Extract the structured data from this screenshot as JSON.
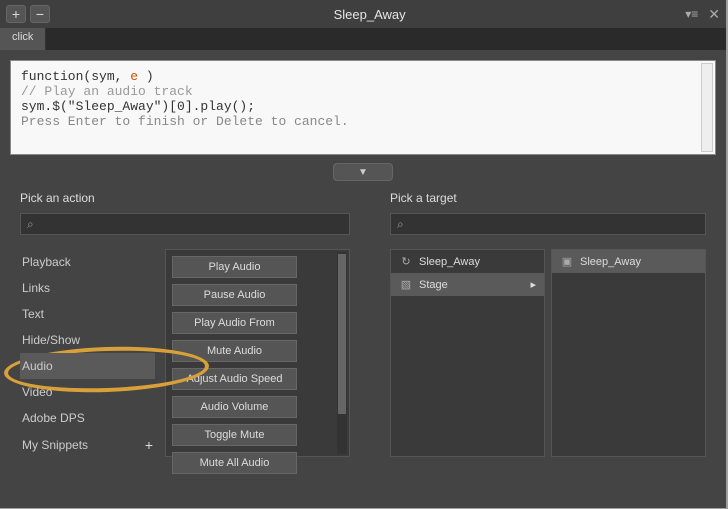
{
  "title": "Sleep_Away",
  "tabs": {
    "click": "click"
  },
  "code": {
    "l1a": "function",
    "l1b": "(sym, ",
    "l1c": "e",
    "l1d": " )",
    "l2": "// Play an audio track",
    "l3": "sym.$(\"Sleep_Away\")[0].play();",
    "l4": "Press Enter to finish or Delete to cancel."
  },
  "labels": {
    "pick_action": "Pick an action",
    "pick_target": "Pick a target"
  },
  "categories": {
    "playback": "Playback",
    "links": "Links",
    "text": "Text",
    "hideshow": "Hide/Show",
    "audio": "Audio",
    "video": "Video",
    "adobedps": "Adobe DPS",
    "mysnippets": "My Snippets"
  },
  "actions": {
    "play": "Play Audio",
    "pause": "Pause Audio",
    "playfrom": "Play Audio From",
    "mute": "Mute Audio",
    "speed": "Adjust Audio Speed",
    "volume": "Audio Volume",
    "togglemute": "Toggle Mute",
    "muteall": "Mute All Audio"
  },
  "targets": {
    "sleep_away": "Sleep_Away",
    "stage": "Stage",
    "sleep_away_r": "Sleep_Away"
  }
}
